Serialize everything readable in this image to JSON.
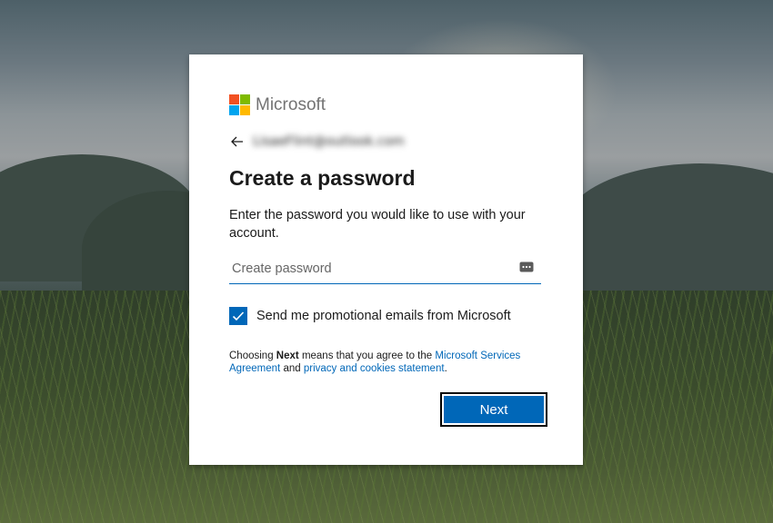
{
  "brand": {
    "name": "Microsoft",
    "colors": [
      "#f25022",
      "#7fba00",
      "#00a4ef",
      "#ffb900"
    ]
  },
  "identity": {
    "email": "LisaeFlint@outlook.com",
    "back_icon": "arrow-left-icon"
  },
  "page": {
    "title": "Create a password",
    "description": "Enter the password you would like to use with your account."
  },
  "password": {
    "placeholder": "Create password",
    "value": "",
    "reveal_icon": "password-reveal-icon"
  },
  "promo": {
    "checked": true,
    "label": "Send me promotional emails from Microsoft"
  },
  "terms": {
    "prefix": "Choosing",
    "bold": "Next",
    "middle": "means that you agree to the",
    "link1": "Microsoft Services Agreement",
    "and": "and",
    "link2": "privacy and cookies statement",
    "suffix": "."
  },
  "actions": {
    "next_label": "Next"
  },
  "theme": {
    "accent": "#0067b8",
    "text": "#1b1b1b"
  }
}
